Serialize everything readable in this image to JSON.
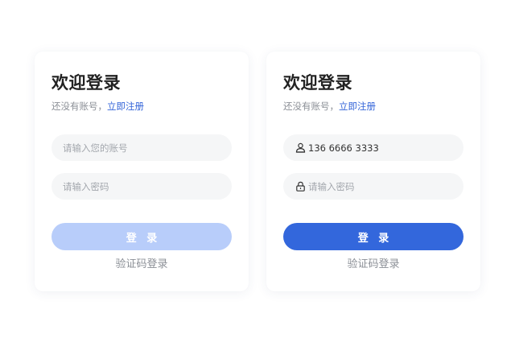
{
  "colors": {
    "accent": "#3367dc",
    "accent_disabled": "#b8cdfa",
    "link": "#3465d9",
    "field_bg": "#f5f6f7",
    "muted_text": "#8b8f96"
  },
  "cards": [
    {
      "state": "empty",
      "title": "欢迎登录",
      "subtitle_prefix": "还没有账号，",
      "register_link": "立即注册",
      "account_placeholder": "请输入您的账号",
      "account_value": "",
      "password_placeholder": "请输入密码",
      "login_button": "登 录",
      "login_enabled": false,
      "alt_login_link": "验证码登录"
    },
    {
      "state": "filled",
      "title": "欢迎登录",
      "subtitle_prefix": "还没有账号，",
      "register_link": "立即注册",
      "account_icon": "user-icon",
      "account_value": "136 6666 3333",
      "password_icon": "lock-icon",
      "password_placeholder": "请输入密码",
      "login_button": "登 录",
      "login_enabled": true,
      "alt_login_link": "验证码登录"
    }
  ]
}
